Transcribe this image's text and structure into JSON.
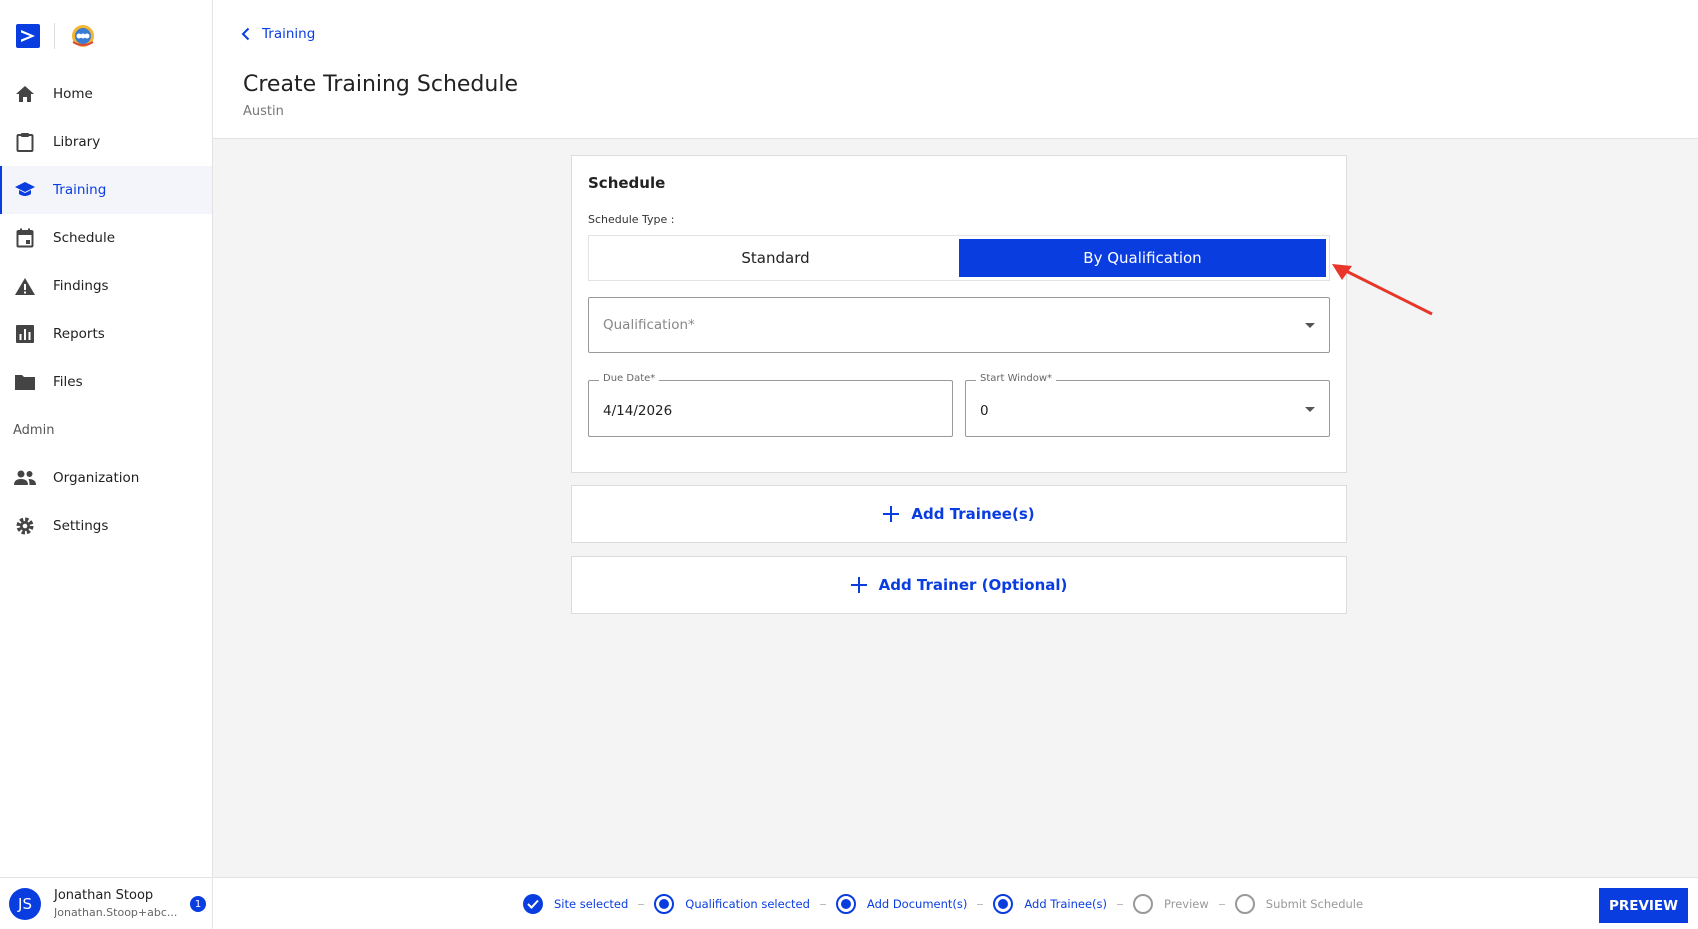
{
  "sidebar": {
    "items": [
      {
        "label": "Home",
        "icon": "home-icon"
      },
      {
        "label": "Library",
        "icon": "clipboard-icon"
      },
      {
        "label": "Training",
        "icon": "graduation-cap-icon",
        "active": true
      },
      {
        "label": "Schedule",
        "icon": "calendar-icon"
      },
      {
        "label": "Findings",
        "icon": "warning-icon"
      },
      {
        "label": "Reports",
        "icon": "bar-chart-icon"
      },
      {
        "label": "Files",
        "icon": "folder-icon"
      }
    ],
    "admin_section": "Admin",
    "admin_items": [
      {
        "label": "Organization",
        "icon": "people-icon"
      },
      {
        "label": "Settings",
        "icon": "gear-icon"
      }
    ],
    "user": {
      "initials": "JS",
      "name": "Jonathan Stoop",
      "email": "Jonathan.Stoop+abc...",
      "notifications": "1"
    }
  },
  "header": {
    "back_label": "Training",
    "title": "Create Training Schedule",
    "subtitle": "Austin"
  },
  "schedule": {
    "title": "Schedule",
    "type_label": "Schedule Type :",
    "type_options": [
      "Standard",
      "By Qualification"
    ],
    "selected_type": "By Qualification",
    "qualification_placeholder": "Qualification*",
    "due_date_label": "Due Date*",
    "due_date_value": "4/14/2026",
    "start_window_label": "Start Window*",
    "start_window_value": "0"
  },
  "actions": {
    "add_trainees": "Add Trainee(s)",
    "add_trainer": "Add Trainer (Optional)"
  },
  "footer": {
    "steps": [
      {
        "label": "Site selected",
        "state": "done"
      },
      {
        "label": "Qualification selected",
        "state": "current"
      },
      {
        "label": "Add Document(s)",
        "state": "current"
      },
      {
        "label": "Add Trainee(s)",
        "state": "current"
      },
      {
        "label": "Preview",
        "state": "todo"
      },
      {
        "label": "Submit Schedule",
        "state": "todo"
      }
    ],
    "preview_button": "PREVIEW"
  },
  "colors": {
    "accent": "#0a3de0",
    "annotation_arrow": "#e8362a"
  }
}
